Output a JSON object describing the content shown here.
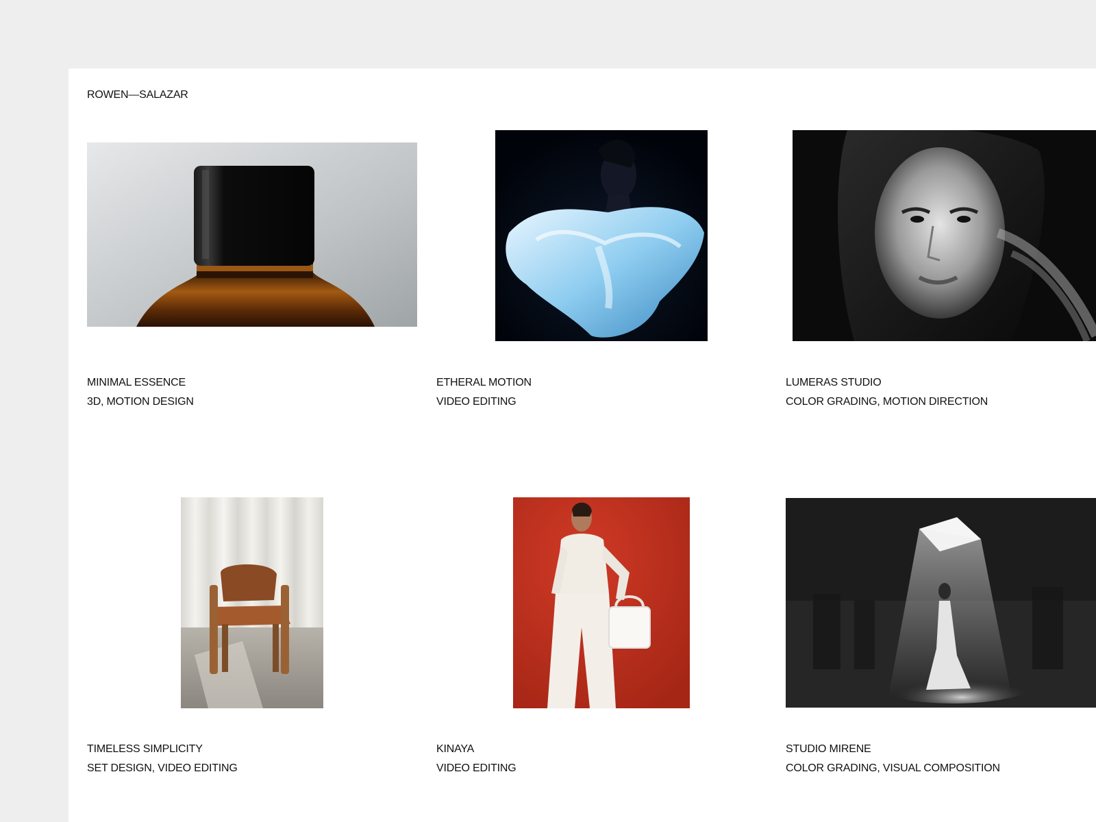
{
  "brand": {
    "name": "ROWEN—SALAZAR"
  },
  "projects": [
    {
      "title": "MINIMAL ESSENCE",
      "tags": "3D, MOTION DESIGN",
      "image": "amber-bottle-photo"
    },
    {
      "title": "ETHERAL MOTION",
      "tags": "VIDEO EDITING",
      "image": "blue-ruffle-dress-portrait"
    },
    {
      "title": "LUMERAS STUDIO",
      "tags": "COLOR GRADING, MOTION DIRECTION",
      "image": "black-and-white-face-portrait"
    },
    {
      "title": "TIMELESS SIMPLICITY",
      "tags": "SET DESIGN, VIDEO EDITING",
      "image": "wooden-chair-photo"
    },
    {
      "title": "KINAYA",
      "tags": "VIDEO EDITING",
      "image": "woman-in-white-on-red-photo"
    },
    {
      "title": "STUDIO MIRENE",
      "tags": "COLOR GRADING, VISUAL COMPOSITION",
      "image": "figure-under-skylight-photo"
    }
  ],
  "colors": {
    "page_background": "#eeeeee",
    "panel_background": "#ffffff",
    "text": "#111111",
    "kinaya_red": "#c0301f"
  }
}
